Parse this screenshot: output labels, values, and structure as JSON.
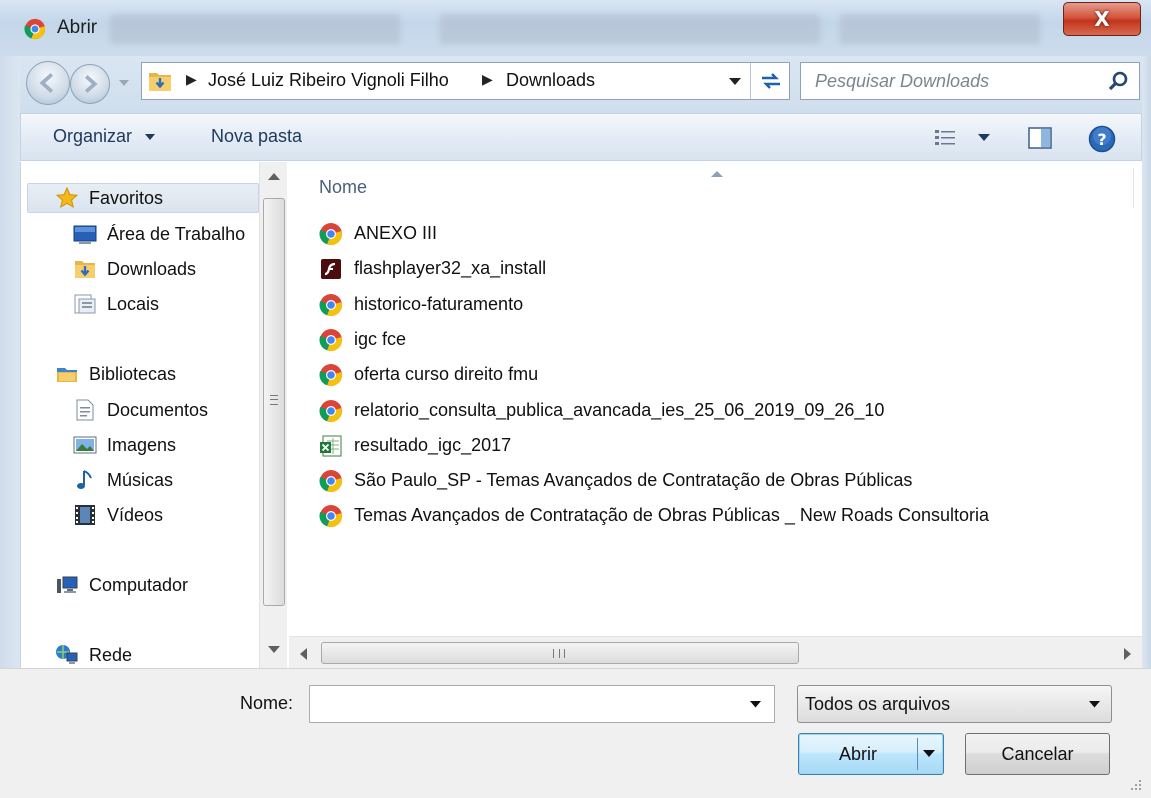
{
  "window": {
    "title": "Abrir",
    "close_label": "X"
  },
  "address": {
    "crumbs": [
      "José Luiz Ribeiro Vignoli Filho",
      "Downloads"
    ],
    "separator": "▶"
  },
  "search": {
    "placeholder": "Pesquisar Downloads"
  },
  "toolbar": {
    "organize_label": "Organizar",
    "new_folder_label": "Nova pasta"
  },
  "navigation": {
    "favorites": {
      "label": "Favoritos",
      "items": [
        "Área de Trabalho",
        "Downloads",
        "Locais"
      ]
    },
    "libraries": {
      "label": "Bibliotecas",
      "items": [
        "Documentos",
        "Imagens",
        "Músicas",
        "Vídeos"
      ]
    },
    "computer_label": "Computador",
    "network_label": "Rede"
  },
  "file_list": {
    "column_name": "Nome",
    "files": [
      {
        "name": "ANEXO III",
        "icon": "chrome-icon"
      },
      {
        "name": "flashplayer32_xa_install",
        "icon": "flash-icon"
      },
      {
        "name": "historico-faturamento",
        "icon": "chrome-icon"
      },
      {
        "name": "igc fce",
        "icon": "chrome-icon"
      },
      {
        "name": "oferta curso direito fmu",
        "icon": "chrome-icon"
      },
      {
        "name": "relatorio_consulta_publica_avancada_ies_25_06_2019_09_26_10",
        "icon": "chrome-icon"
      },
      {
        "name": "resultado_igc_2017",
        "icon": "excel-icon"
      },
      {
        "name": "São Paulo_SP - Temas Avançados de Contratação de Obras Públicas",
        "icon": "chrome-icon"
      },
      {
        "name": "Temas Avançados de Contratação de Obras Públicas _ New Roads Consultoria",
        "icon": "chrome-icon"
      }
    ]
  },
  "bottom": {
    "filename_label": "Nome:",
    "filename_value": "",
    "filetype_value": "Todos os arquivos",
    "open_label": "Abrir",
    "cancel_label": "Cancelar"
  },
  "colors": {
    "accent": "#1e395b",
    "close_button": "#c8422a",
    "open_button": "#a6d9f4"
  }
}
